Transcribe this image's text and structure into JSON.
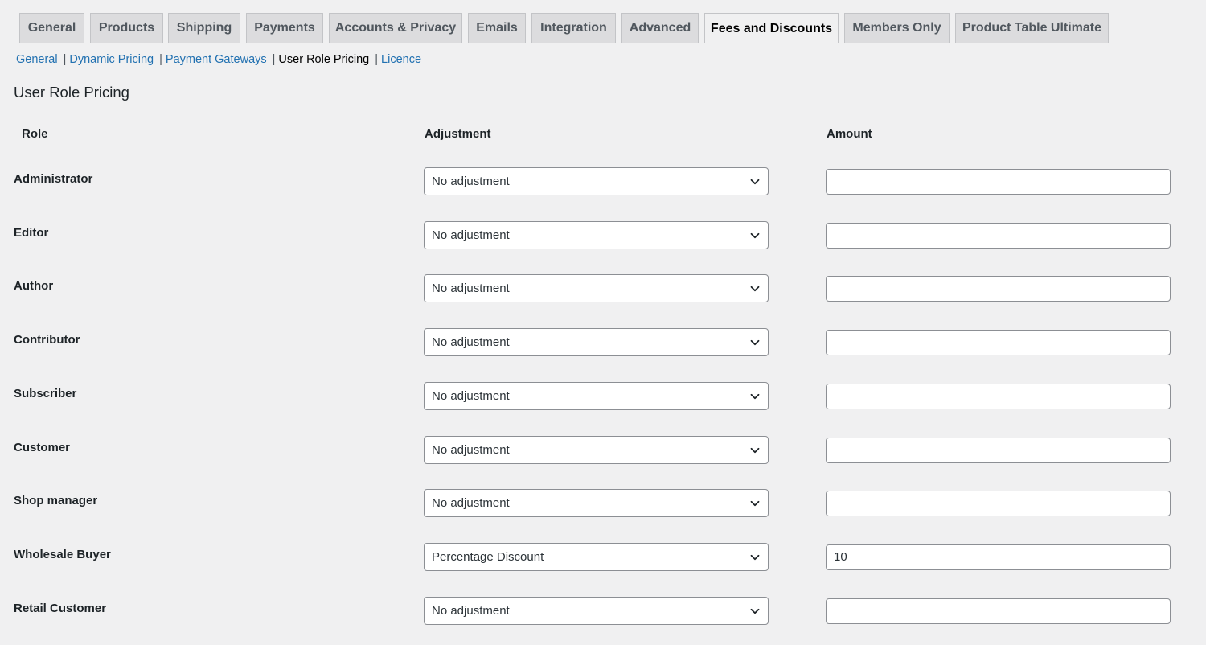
{
  "tabs": [
    {
      "label": "General",
      "active": false
    },
    {
      "label": "Products",
      "active": false
    },
    {
      "label": "Shipping",
      "active": false
    },
    {
      "label": "Payments",
      "active": false
    },
    {
      "label": "Accounts & Privacy",
      "active": false
    },
    {
      "label": "Emails",
      "active": false
    },
    {
      "label": "Integration",
      "active": false
    },
    {
      "label": "Advanced",
      "active": false
    },
    {
      "label": "Fees and Discounts",
      "active": true
    },
    {
      "label": "Members Only",
      "active": false
    },
    {
      "label": "Product Table Ultimate",
      "active": false
    }
  ],
  "subnav": [
    {
      "label": "General",
      "current": false
    },
    {
      "label": "Dynamic Pricing",
      "current": false
    },
    {
      "label": "Payment Gateways",
      "current": false
    },
    {
      "label": "User Role Pricing",
      "current": true
    },
    {
      "label": "Licence",
      "current": false
    }
  ],
  "subnav_separator": "|",
  "section_title": "User Role Pricing",
  "columns": {
    "role": "Role",
    "adjustment": "Adjustment",
    "amount": "Amount"
  },
  "rows": [
    {
      "role": "Administrator",
      "adjustment": "No adjustment",
      "amount": ""
    },
    {
      "role": "Editor",
      "adjustment": "No adjustment",
      "amount": ""
    },
    {
      "role": "Author",
      "adjustment": "No adjustment",
      "amount": ""
    },
    {
      "role": "Contributor",
      "adjustment": "No adjustment",
      "amount": ""
    },
    {
      "role": "Subscriber",
      "adjustment": "No adjustment",
      "amount": ""
    },
    {
      "role": "Customer",
      "adjustment": "No adjustment",
      "amount": ""
    },
    {
      "role": "Shop manager",
      "adjustment": "No adjustment",
      "amount": ""
    },
    {
      "role": "Wholesale Buyer",
      "adjustment": "Percentage Discount",
      "amount": "10"
    },
    {
      "role": "Retail Customer",
      "adjustment": "No adjustment",
      "amount": ""
    }
  ],
  "icons": {
    "select_arrow": "chevron-down-icon"
  },
  "colors": {
    "link": "#2271b1",
    "background": "#f0f0f1",
    "tab_inactive": "#dcdcde"
  }
}
